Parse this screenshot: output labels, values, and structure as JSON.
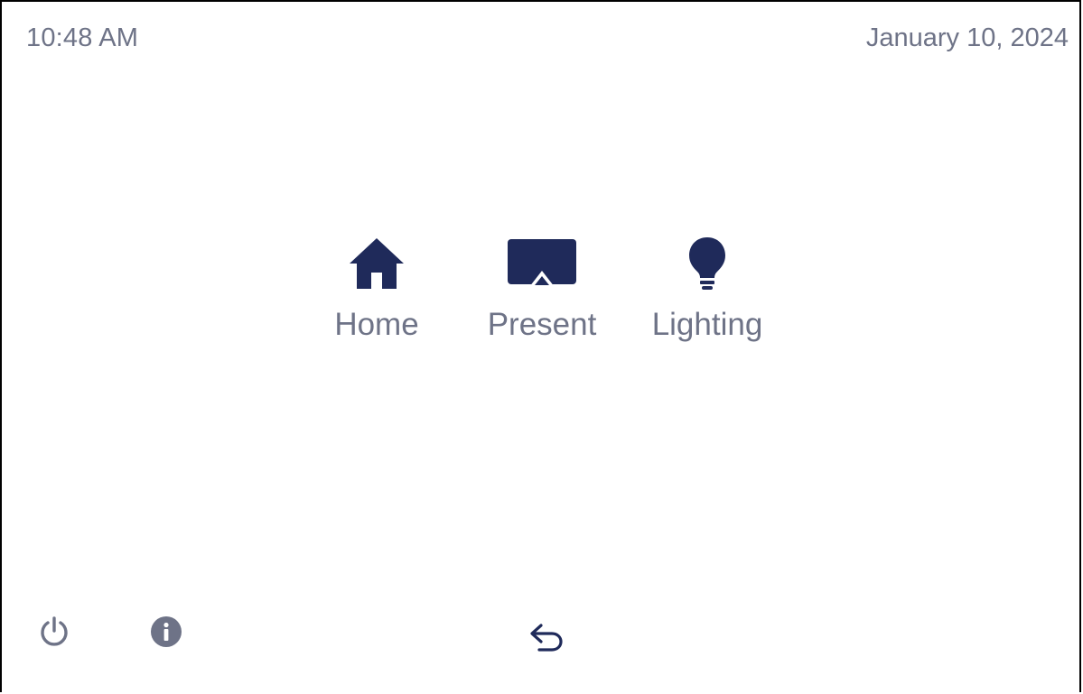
{
  "status_bar": {
    "time": "10:48 AM",
    "date": "January 10, 2024"
  },
  "nav": {
    "items": [
      {
        "label": "Home",
        "icon": "home-icon"
      },
      {
        "label": "Present",
        "icon": "present-icon"
      },
      {
        "label": "Lighting",
        "icon": "lightbulb-icon"
      }
    ]
  },
  "footer": {
    "power_icon": "power-icon",
    "info_icon": "info-icon",
    "back_icon": "back-arrow-icon"
  },
  "colors": {
    "icon_primary": "#1f2a5a",
    "text_muted": "#6e7387",
    "icon_muted": "#6e7387"
  }
}
